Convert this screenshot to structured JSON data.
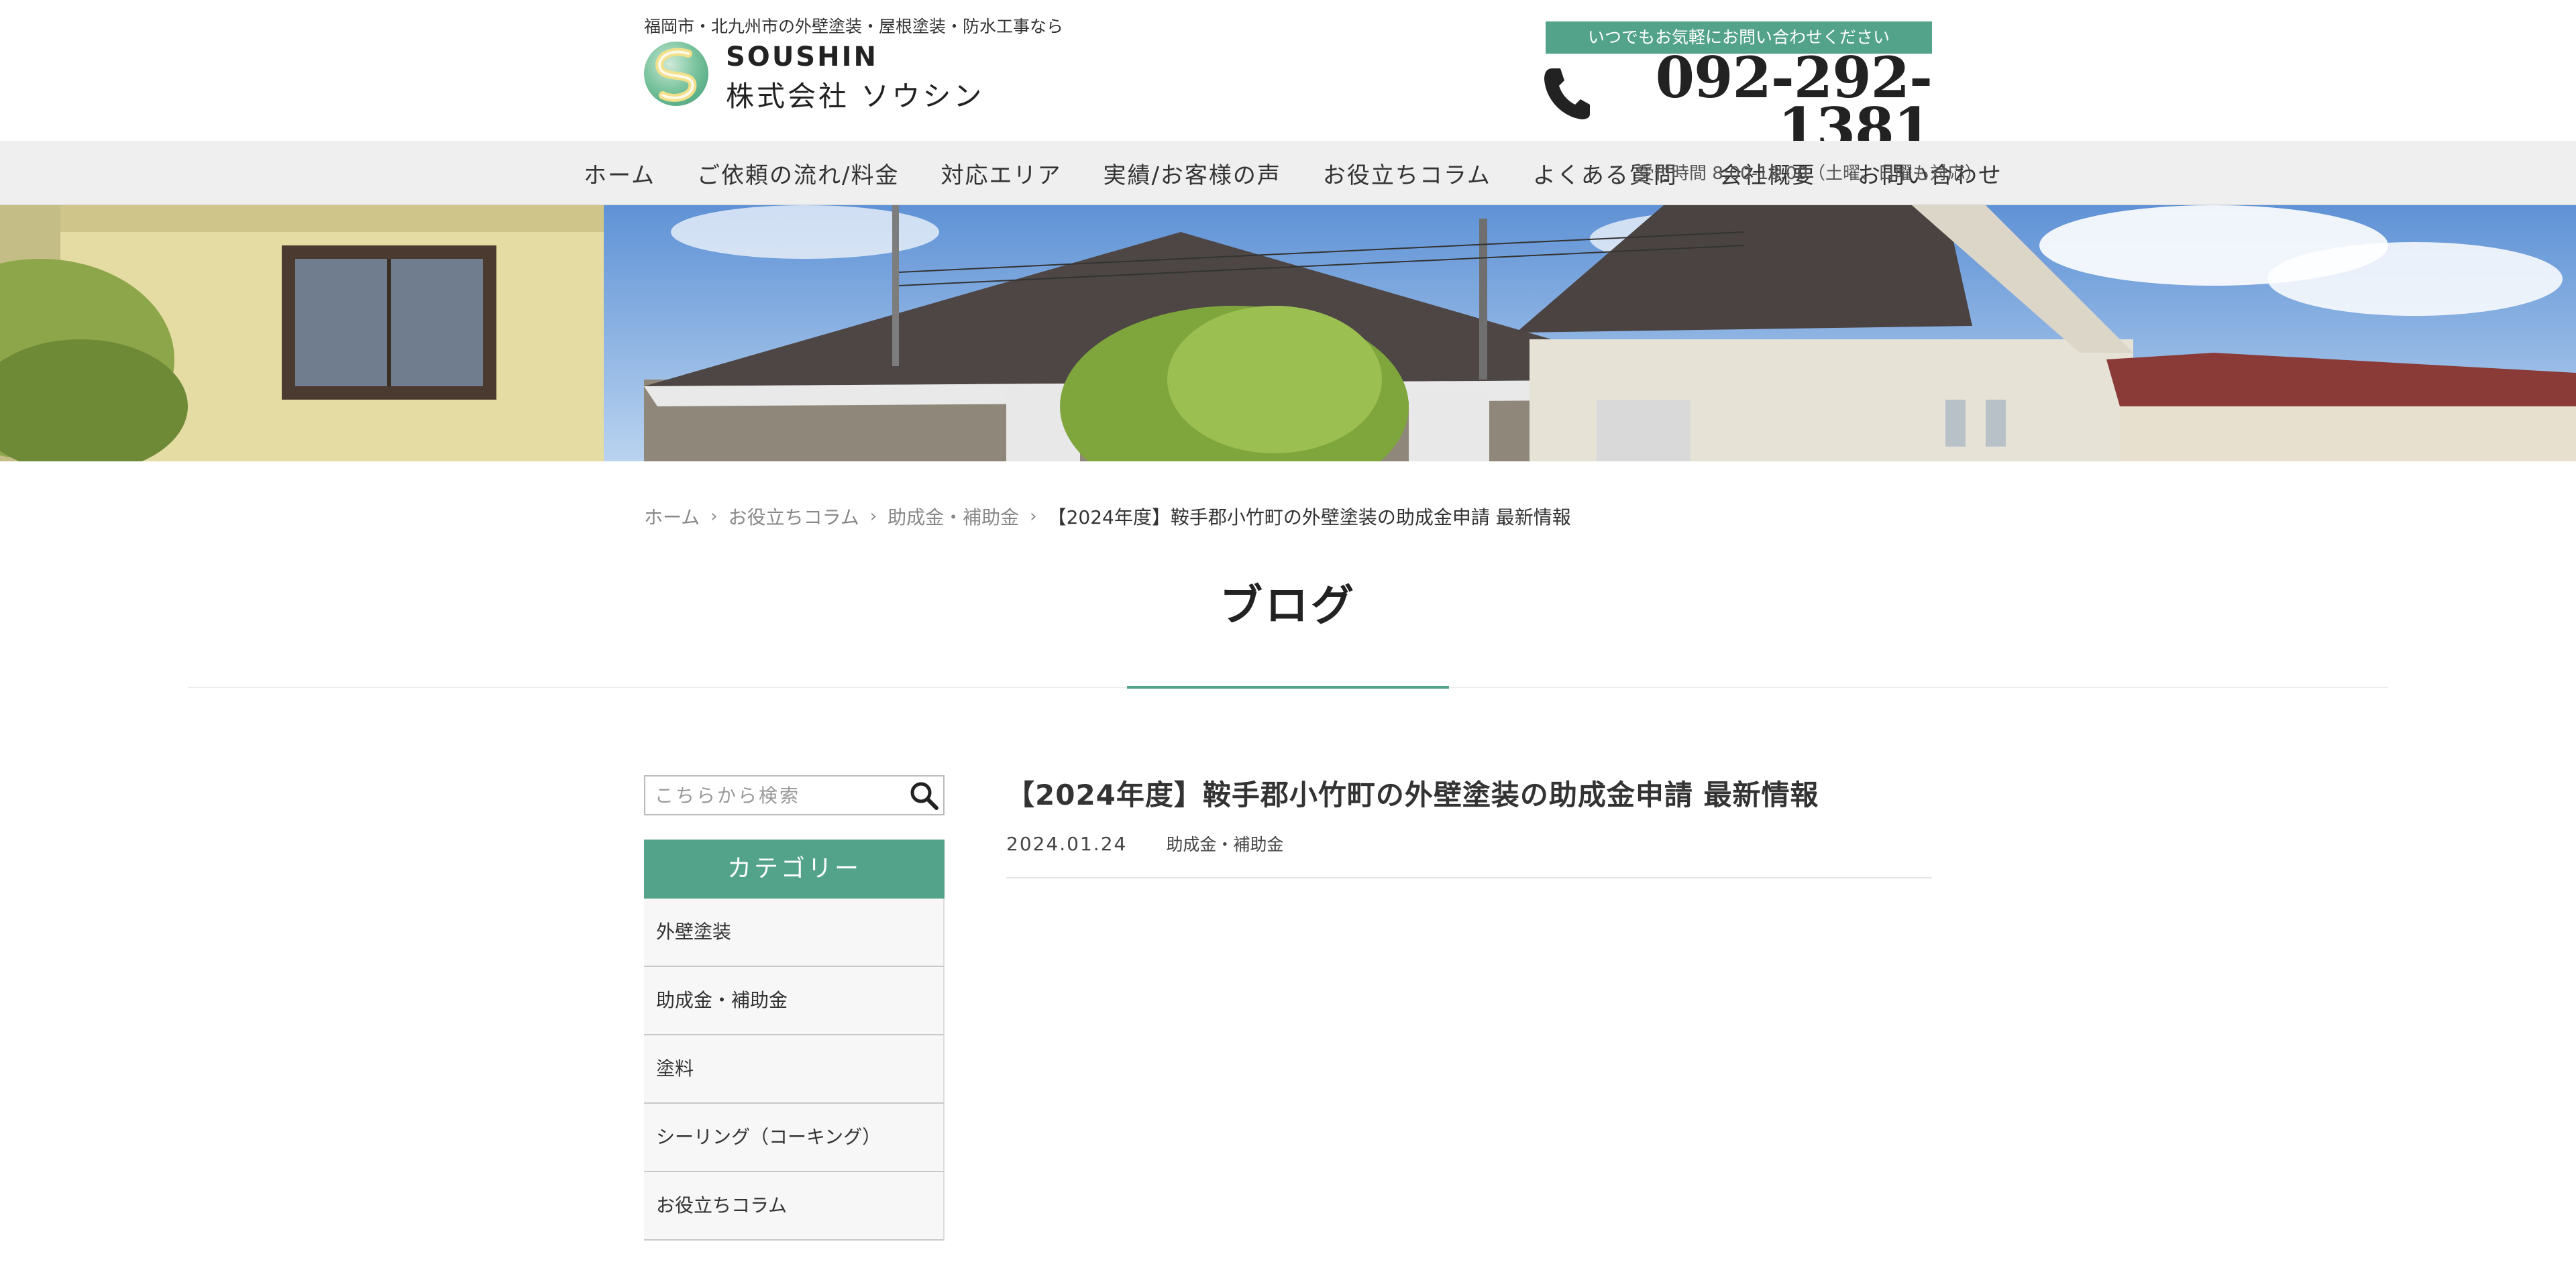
{
  "header": {
    "tagline": "福岡市・北九州市の外壁塗装・屋根塗装・防水工事なら",
    "logo_en": "SOUSHIN",
    "logo_ja": "株式会社 ソウシン",
    "contact_badge": "いつでもお気軽にお問い合わせください",
    "phone": "092-292-1381",
    "hours": "受付時間 8:00-18:00（土曜、日曜も対応）"
  },
  "nav": {
    "items": [
      "ホーム",
      "ご依頼の流れ/料金",
      "対応エリア",
      "実績/お客様の声",
      "お役立ちコラム",
      "よくある質問",
      "会社概要",
      "お問い合わせ"
    ]
  },
  "breadcrumb": {
    "items": [
      "ホーム",
      "お役立ちコラム",
      "助成金・補助金"
    ],
    "current": "【2024年度】鞍手郡小竹町の外壁塗装の助成金申請 最新情報"
  },
  "page": {
    "title": "ブログ"
  },
  "sidebar": {
    "search_placeholder": "こちらから検索",
    "category_heading": "カテゴリー",
    "categories": [
      "外壁塗装",
      "助成金・補助金",
      "塗料",
      "シーリング（コーキング）",
      "お役立ちコラム"
    ]
  },
  "post": {
    "title": "【2024年度】鞍手郡小竹町の外壁塗装の助成金申請 最新情報",
    "date": "2024.01.24",
    "category": "助成金・補助金"
  },
  "colors": {
    "accent": "#53a38a",
    "nav_bg": "#efefef",
    "sidebar_item_bg": "#f7f7f7"
  },
  "icons": {
    "phone": "phone-icon",
    "search": "search-icon",
    "breadcrumb_separator": "chevron-right-icon",
    "logo": "logo-icon"
  }
}
